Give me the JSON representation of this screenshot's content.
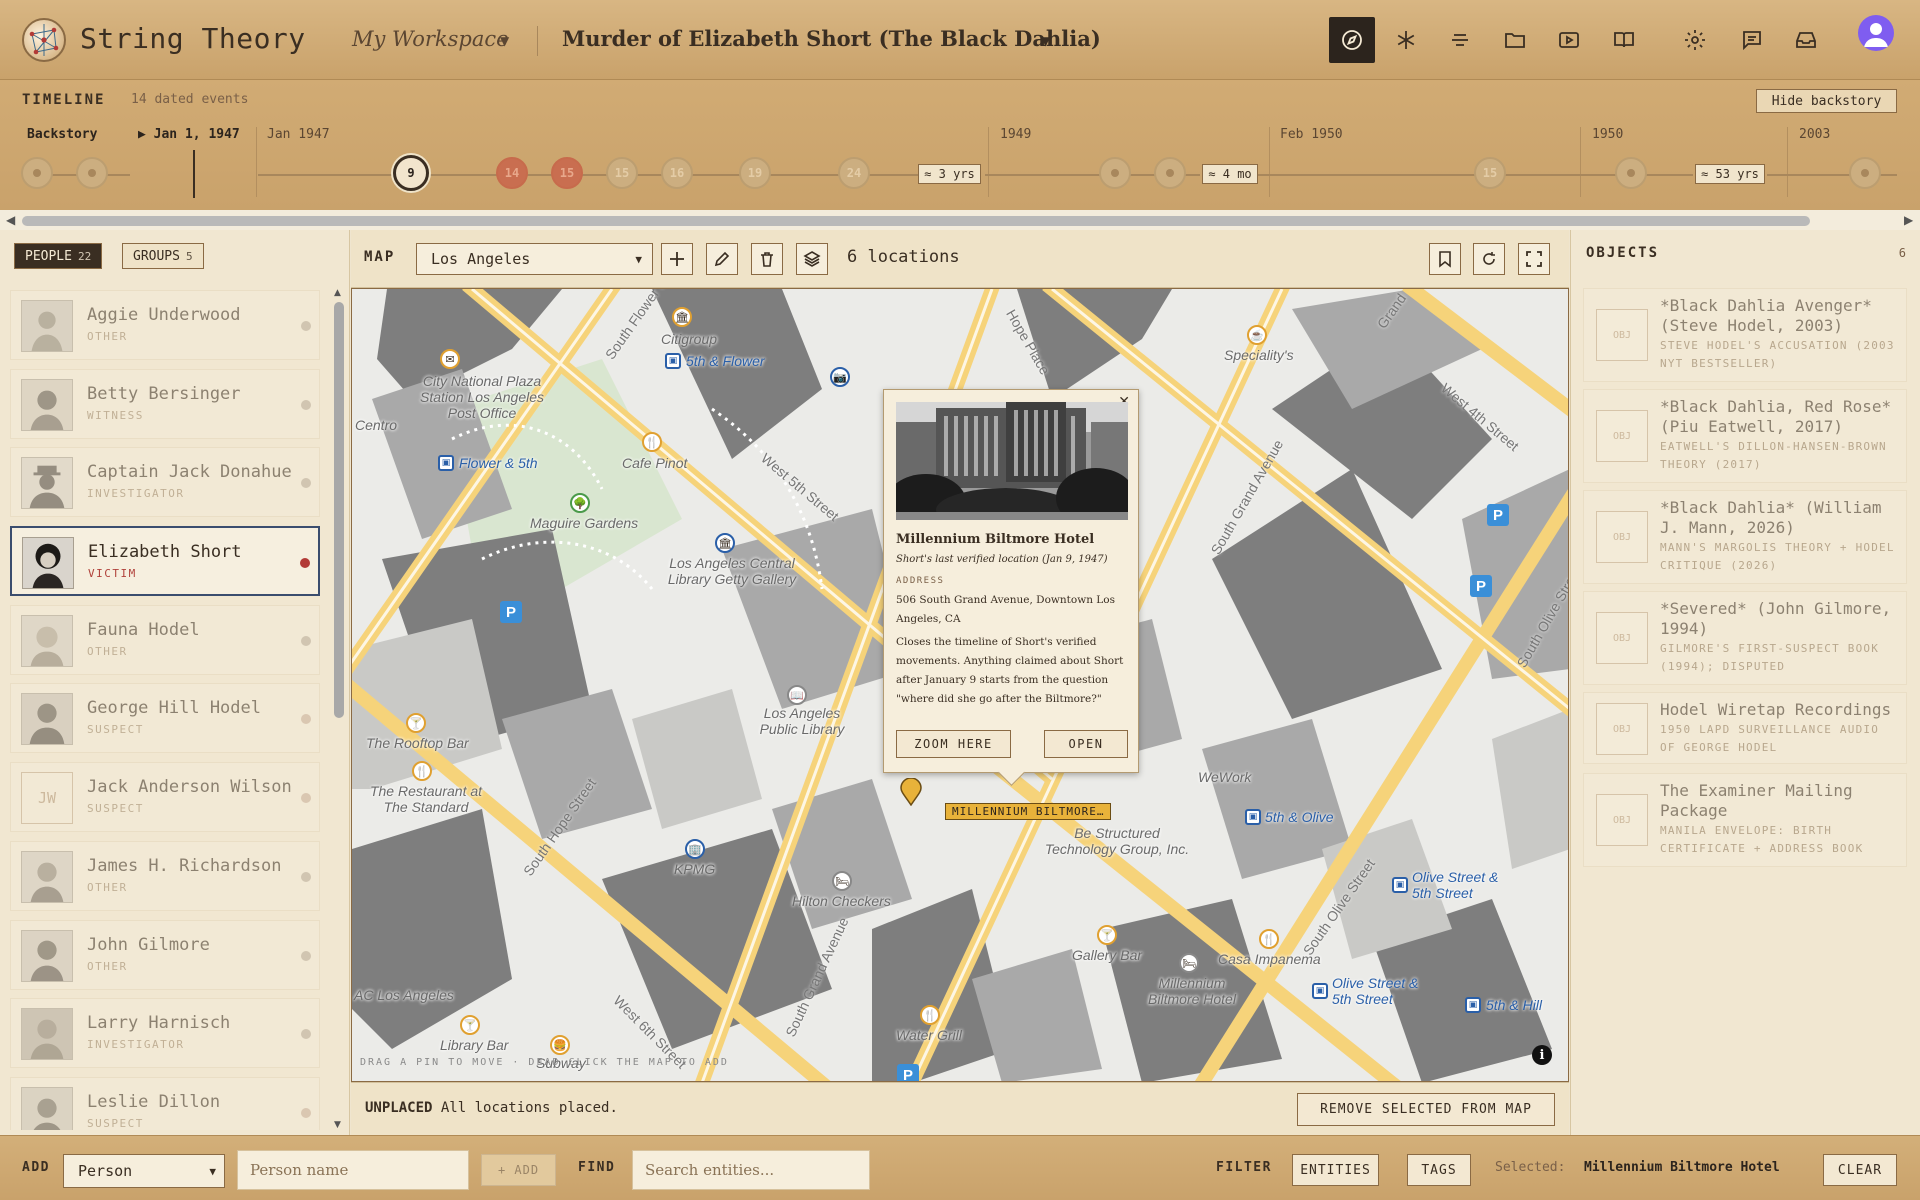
{
  "app": {
    "title": "String Theory"
  },
  "header": {
    "workspace": "My Workspace",
    "case_title": "Murder of Elizabeth Short (The Black Dahlia)",
    "icons": [
      "compass-icon",
      "asterisk-icon",
      "lines-icon",
      "folder-icon",
      "play-icon",
      "book-icon",
      "gear-icon",
      "chat-icon",
      "inbox-icon",
      "avatar"
    ]
  },
  "timeline": {
    "title": "TIMELINE",
    "count": "14 dated events",
    "hide_label": "Hide backstory",
    "backstory_label": "Backstory",
    "current_date": "▶ Jan 1, 1947",
    "periods": [
      "Jan 1947",
      "1949",
      "Feb 1950",
      "1950",
      "2003"
    ],
    "events": [
      "9",
      "14",
      "15",
      "15",
      "16",
      "19",
      "24",
      "15"
    ],
    "gaps": [
      "≈ 3 yrs",
      "≈ 4 mo",
      "≈ 53 yrs"
    ]
  },
  "left": {
    "tab_people": "PEOPLE",
    "people_count": "22",
    "tab_groups": "GROUPS",
    "groups_count": "5",
    "people": [
      {
        "name": "Aggie Underwood",
        "role": "OTHER"
      },
      {
        "name": "Betty Bersinger",
        "role": "WITNESS"
      },
      {
        "name": "Captain Jack Donahue",
        "role": "INVESTIGATOR"
      },
      {
        "name": "Elizabeth Short",
        "role": "VICTIM"
      },
      {
        "name": "Fauna Hodel",
        "role": "OTHER"
      },
      {
        "name": "George Hill Hodel",
        "role": "SUSPECT"
      },
      {
        "name": "Jack Anderson Wilson",
        "role": "SUSPECT",
        "initials": "JW"
      },
      {
        "name": "James H. Richardson",
        "role": "OTHER"
      },
      {
        "name": "John Gilmore",
        "role": "OTHER"
      },
      {
        "name": "Larry Harnisch",
        "role": "INVESTIGATOR"
      },
      {
        "name": "Leslie Dillon",
        "role": "SUSPECT"
      }
    ]
  },
  "map": {
    "title": "MAP",
    "city": "Los Angeles",
    "locations": "6 locations",
    "hint": "DRAG A PIN TO MOVE · DEAD CLICK THE MAP TO ADD",
    "streets": [
      "South Flower Street",
      "Hope Place",
      "West 5th Street",
      "South Grand Avenue",
      "West 4th Street",
      "South Olive Street",
      "South Hope Street",
      "West 6th Street",
      "South Grand Avenue",
      "South Olive Street",
      "Grand"
    ],
    "pois": [
      "Citigroup",
      "5th & Flower",
      "City National Plaza Station Los Angeles Post Office",
      "Centro",
      "Flower & 5th",
      "Cafe Pinot",
      "Maguire Gardens",
      "Los Angeles Central Library Getty Gallery",
      "Los Angeles Public Library",
      "Speciality's",
      "WeWork",
      "5th & Olive",
      "Be Structured Technology Group, Inc.",
      "The Rooftop Bar",
      "The Restaurant at The Standard",
      "KPMG",
      "Hilton Checkers",
      "Gallery Bar",
      "Casa Impanema",
      "Olive Street & 5th Street",
      "Olive Street & 5th Street",
      "5th & Hill",
      "Millennium Biltmore Hotel",
      "Water Grill",
      "AC Los Angeles",
      "Library Bar",
      "Subway"
    ],
    "popup": {
      "name": "Millennium Biltmore Hotel",
      "subtitle": "Short's last verified location (Jan 9, 1947)",
      "address_label": "ADDRESS",
      "address": "506 South Grand Avenue, Downtown Los Angeles, CA",
      "description": "Closes the timeline of Short's verified movements. Anything claimed about Short after January 9 starts from the question \"where did she go after the Biltmore?\"",
      "zoom_label": "ZOOM HERE",
      "open_label": "OPEN"
    },
    "marker_label": "MILLENNIUM BILTMORE…",
    "unplaced_label": "UNPLACED",
    "unplaced_text": "All locations placed.",
    "remove_label": "REMOVE SELECTED FROM MAP"
  },
  "objects": {
    "title": "OBJECTS",
    "count": "6",
    "thumb": "OBJ",
    "items": [
      {
        "title": "*Black Dahlia Avenger* (Steve Hodel, 2003)",
        "desc": "STEVE HODEL'S ACCUSATION (2003 NYT BESTSELLER)"
      },
      {
        "title": "*Black Dahlia, Red Rose* (Piu Eatwell, 2017)",
        "desc": "EATWELL'S DILLON-HANSEN-BROWN THEORY (2017)"
      },
      {
        "title": "*Black Dahlia* (William J. Mann, 2026)",
        "desc": "MANN'S MARGOLIS THEORY + HODEL CRITIQUE (2026)"
      },
      {
        "title": "*Severed* (John Gilmore, 1994)",
        "desc": "GILMORE'S FIRST-SUSPECT BOOK (1994); DISPUTED"
      },
      {
        "title": "Hodel Wiretap Recordings",
        "desc": "1950 LAPD SURVEILLANCE AUDIO OF GEORGE HODEL"
      },
      {
        "title": "The Examiner Mailing Package",
        "desc": "MANILA ENVELOPE: BIRTH CERTIFICATE + ADDRESS BOOK"
      }
    ]
  },
  "bottom": {
    "add_label": "ADD",
    "add_type": "Person",
    "name_placeholder": "Person name",
    "add_button": "+ ADD",
    "find_label": "FIND",
    "search_placeholder": "Search entities...",
    "filter_label": "FILTER",
    "entities_button": "ENTITIES",
    "tags_button": "TAGS",
    "selected_label": "Selected:",
    "selected_value": "Millennium Biltmore Hotel",
    "clear_button": "CLEAR"
  },
  "colors": {
    "accent": "#c9a26b",
    "dark": "#2c241d",
    "victim": "#b23a36",
    "marker": "#e8b23a",
    "transit": "#2a5fa8"
  }
}
